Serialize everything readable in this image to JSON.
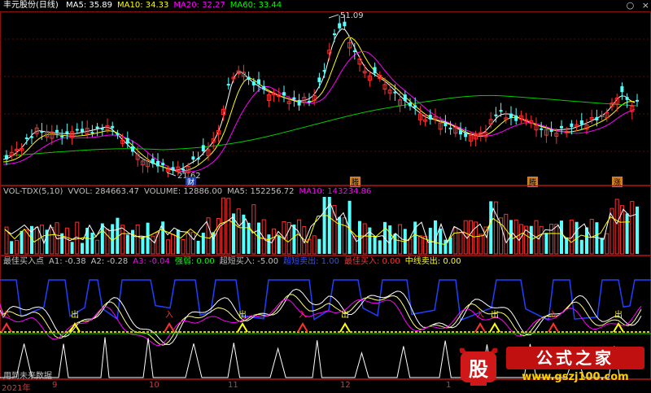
{
  "window": {
    "title": "丰元股份(日线)",
    "controls": [
      "○",
      "×"
    ]
  },
  "main": {
    "ma": [
      {
        "label": "MA5: 35.89",
        "color": "#ffffff"
      },
      {
        "label": "MA10: 34.33",
        "color": "#ffff00"
      },
      {
        "label": "MA20: 32.27",
        "color": "#ff00ff"
      },
      {
        "label": "MA60: 33.44",
        "color": "#00ff00"
      }
    ],
    "high_label": "51.09",
    "low_label": "21.62",
    "tags": [
      "财",
      "腾",
      "腾",
      "涨"
    ]
  },
  "volume": {
    "items": [
      {
        "label": "VOL-TDX(5,10)",
        "color": "#c0c0c0"
      },
      {
        "label": "VVOL: 284663.47",
        "color": "#c0c0c0"
      },
      {
        "label": "VOLUME: 12886.00",
        "color": "#c0c0c0"
      },
      {
        "label": "MA5: 152256.72",
        "color": "#c0c0c0"
      },
      {
        "label": "MA10: 143234.86",
        "color": "#ff00ff"
      }
    ]
  },
  "indicator": {
    "items": [
      {
        "label": "最佳买入点",
        "color": "#c0c0c0"
      },
      {
        "label": "A1: -0.38",
        "color": "#c0c0c0"
      },
      {
        "label": "A2: -0.28",
        "color": "#c0c0c0"
      },
      {
        "label": "A3: -0.04",
        "color": "#ff00ff"
      },
      {
        "label": "强弱: 0.00",
        "color": "#00ff00"
      },
      {
        "label": "超短买入: -5.00",
        "color": "#c0c0c0"
      },
      {
        "label": "超短卖出: 1.00",
        "color": "#3050ff"
      },
      {
        "label": "最佳买入: 0.00",
        "color": "#ff3030"
      },
      {
        "label": "中线卖出: 0.00",
        "color": "#ffff00"
      }
    ],
    "buy_label": "入",
    "sell_label": "出"
  },
  "bottom_note": "用到未来数据",
  "xaxis": [
    "2021年",
    "9",
    "10",
    "11",
    "12",
    "1"
  ],
  "watermark": {
    "title": "公式之家",
    "url": "www.gszj100.com",
    "icon_char": "股"
  },
  "chart_data": [
    {
      "type": "candlestick",
      "title": "丰元股份(日线)",
      "labels": [
        "51.09",
        "21.62"
      ],
      "series": [
        {
          "name": "MA5",
          "values": [
            35.89
          ]
        },
        {
          "name": "MA10",
          "values": [
            34.33
          ]
        },
        {
          "name": "MA20",
          "values": [
            32.27
          ]
        },
        {
          "name": "MA60",
          "values": [
            33.44
          ]
        }
      ],
      "high": 51.09,
      "low": 21.62
    },
    {
      "type": "bar",
      "title": "VOL-TDX(5,10)",
      "series": [
        {
          "name": "VVOL",
          "values": [
            284663.47
          ]
        },
        {
          "name": "VOLUME",
          "values": [
            12886.0
          ]
        },
        {
          "name": "MA5",
          "values": [
            152256.72
          ]
        },
        {
          "name": "MA10",
          "values": [
            143234.86
          ]
        }
      ]
    },
    {
      "type": "line",
      "title": "最佳买入点",
      "series": [
        {
          "name": "A1",
          "values": [
            -0.38
          ]
        },
        {
          "name": "A2",
          "values": [
            -0.28
          ]
        },
        {
          "name": "A3",
          "values": [
            -0.04
          ]
        },
        {
          "name": "强弱",
          "values": [
            0.0
          ]
        },
        {
          "name": "超短买入",
          "values": [
            -5.0
          ]
        },
        {
          "name": "超短卖出",
          "values": [
            1.0
          ]
        },
        {
          "name": "最佳买入",
          "values": [
            0.0
          ]
        },
        {
          "name": "中线卖出",
          "values": [
            0.0
          ]
        }
      ]
    }
  ]
}
